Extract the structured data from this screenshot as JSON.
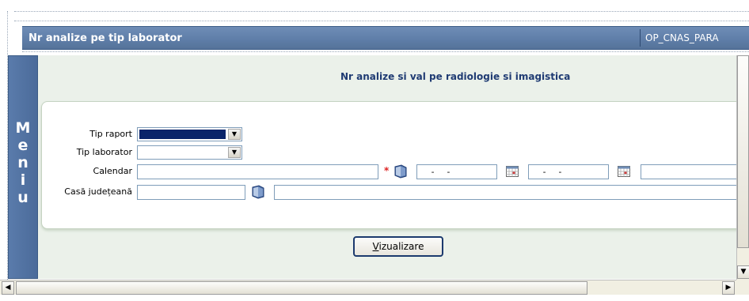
{
  "header": {
    "title": "Nr analize pe tip laborator",
    "code": "OP_CNAS_PARA"
  },
  "menu": {
    "letters": "M\ne\nn\ni\nu"
  },
  "report": {
    "title": "Nr analize si val pe radiologie si imagistica"
  },
  "form": {
    "tip_raport_label": "Tip raport",
    "tip_laborator_label": "Tip laborator",
    "calendar_label": "Calendar",
    "casa_label": "Casă județeană",
    "date_from_value": "  -  -",
    "date_to_value": "  -  -",
    "required_mark": "*"
  },
  "actions": {
    "view_prefix": "V",
    "view_rest": "izualizare"
  },
  "colors": {
    "accent": "#5f7ea9",
    "menu": "#4b6b9a",
    "content_bg": "#ebf1ea",
    "selected_fill": "#0a246a"
  }
}
